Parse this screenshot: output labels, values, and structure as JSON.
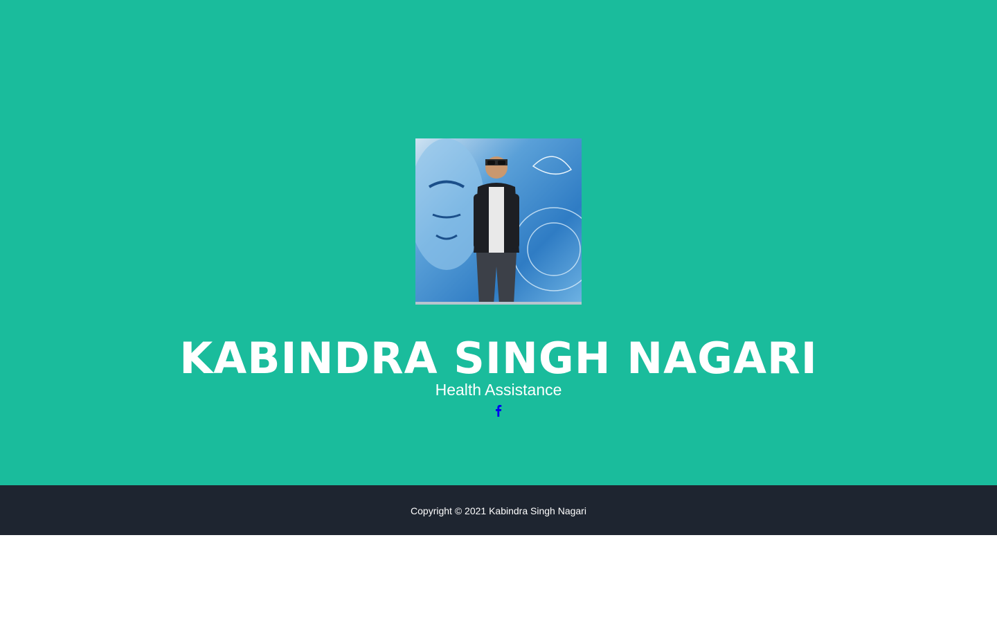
{
  "colors": {
    "hero_background": "#1abc9c",
    "footer_background": "#1e2530",
    "text": "#ffffff",
    "social_icon": "#0000ee"
  },
  "profile": {
    "name": "KABINDRA SINGH NAGARI",
    "role": "Health Assistance",
    "photo_icon": "profile-photo"
  },
  "social": {
    "icon": "facebook-icon"
  },
  "footer": {
    "copyright": "Copyright © 2021 Kabindra Singh Nagari"
  }
}
